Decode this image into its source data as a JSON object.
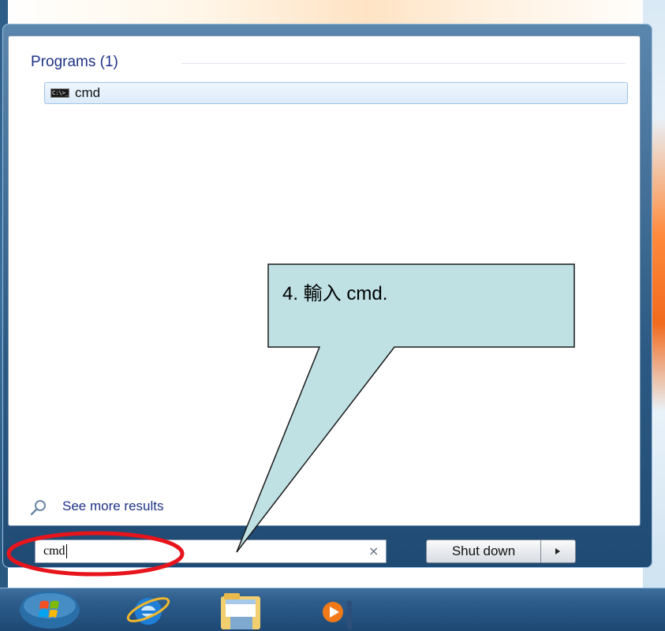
{
  "search_results": {
    "group_header": "Programs (1)",
    "items": [
      {
        "label": "cmd",
        "icon": "cmd-icon",
        "icon_text": "C:\\>_"
      }
    ],
    "see_more_label": "See more results"
  },
  "search": {
    "value": "cmd",
    "clear_symbol": "×"
  },
  "shutdown": {
    "label": "Shut down"
  },
  "annotation": {
    "callout_text": "4.  輸入  cmd.",
    "callout_fill": "#bfe1e4",
    "highlight_color": "#e8141c"
  },
  "taskbar": {
    "items": [
      "start-orb-icon",
      "internet-explorer-icon",
      "file-explorer-icon",
      "media-player-icon"
    ]
  }
}
